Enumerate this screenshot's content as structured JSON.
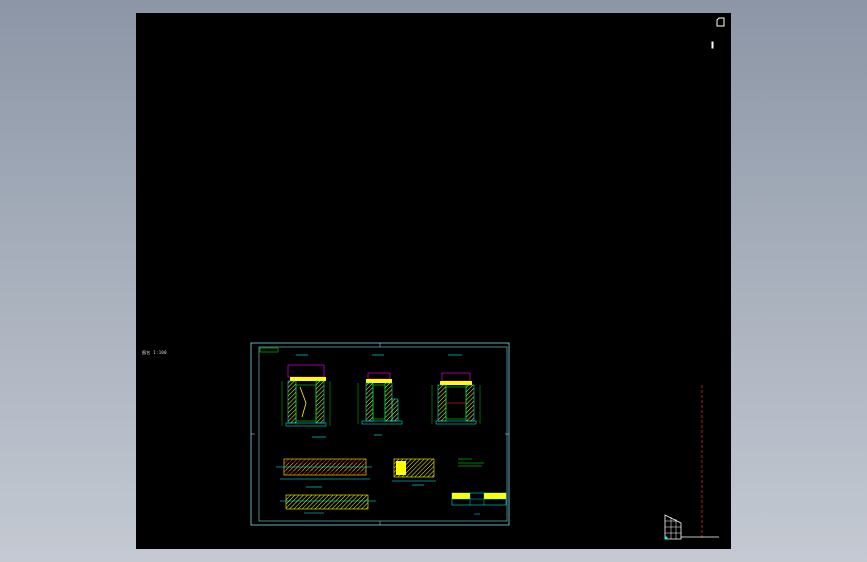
{
  "viewport": {
    "side_label": "图名 1:100",
    "icons": [
      "viewcube-icon",
      "navbar-icon",
      "ucs-icon"
    ]
  },
  "colors": {
    "background_start": "#8c96a6",
    "background_end": "#c4c9d2",
    "model_space": "#000000",
    "frame": "#7fd6e6",
    "cad_yellow": "#ffff00",
    "cad_green": "#00ff00",
    "cad_cyan": "#00ffff",
    "cad_red": "#ff3030",
    "cad_magenta": "#ff00ff",
    "ucs_white": "#ffffff"
  }
}
